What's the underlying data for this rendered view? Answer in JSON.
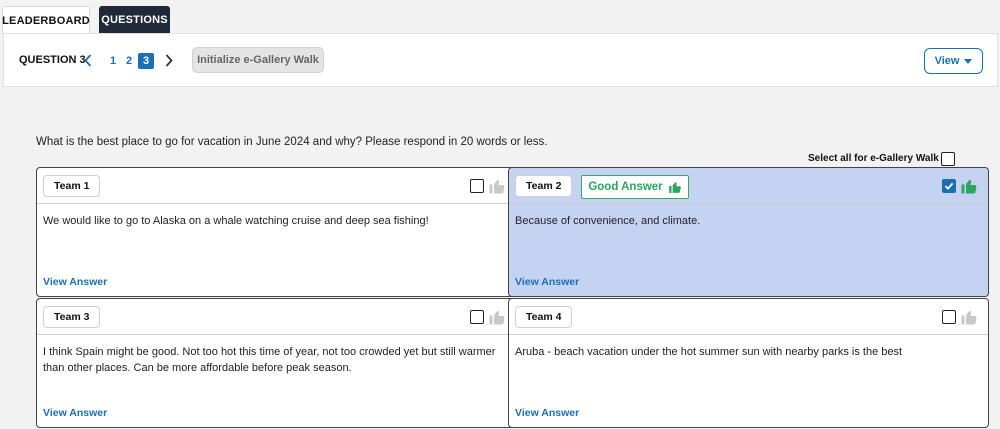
{
  "tabs": [
    {
      "label": "LEADERBOARD"
    },
    {
      "label": "QUESTIONS"
    }
  ],
  "toolbar": {
    "question_label": "QUESTION 3",
    "pages": [
      "1",
      "2",
      "3"
    ],
    "current_page": "3",
    "gallery_button": "Initialize e-Gallery Walk",
    "view_button": "View"
  },
  "question": "What is the best place to go for vacation in June 2024 and why? Please respond in 20 words or less.",
  "select_all_label": "Select all for e-Gallery Walk",
  "good_answer_label": "Good Answer",
  "view_answer_label": "View Answer",
  "cards": [
    {
      "team": "Team 1",
      "answer": "We would like to go to Alaska on a whale watching cruise and deep sea fishing!",
      "checked": false,
      "good": false
    },
    {
      "team": "Team 2",
      "answer": "Because of convenience, and climate.",
      "checked": true,
      "good": true
    },
    {
      "team": "Team 3",
      "answer": "I think Spain might be good. Not too hot this time of year, not too crowded yet but still warmer than other places. Can be more affordable before peak season.",
      "checked": false,
      "good": false
    },
    {
      "team": "Team 4",
      "answer": "Aruba - beach vacation under the hot summer sun with nearby parks is the best",
      "checked": false,
      "good": false
    }
  ],
  "colors": {
    "accent": "#1a6fb5",
    "good": "#2ea55e",
    "selected_card": "#c5d3f2",
    "thumb_off": "#c8c8c8"
  }
}
